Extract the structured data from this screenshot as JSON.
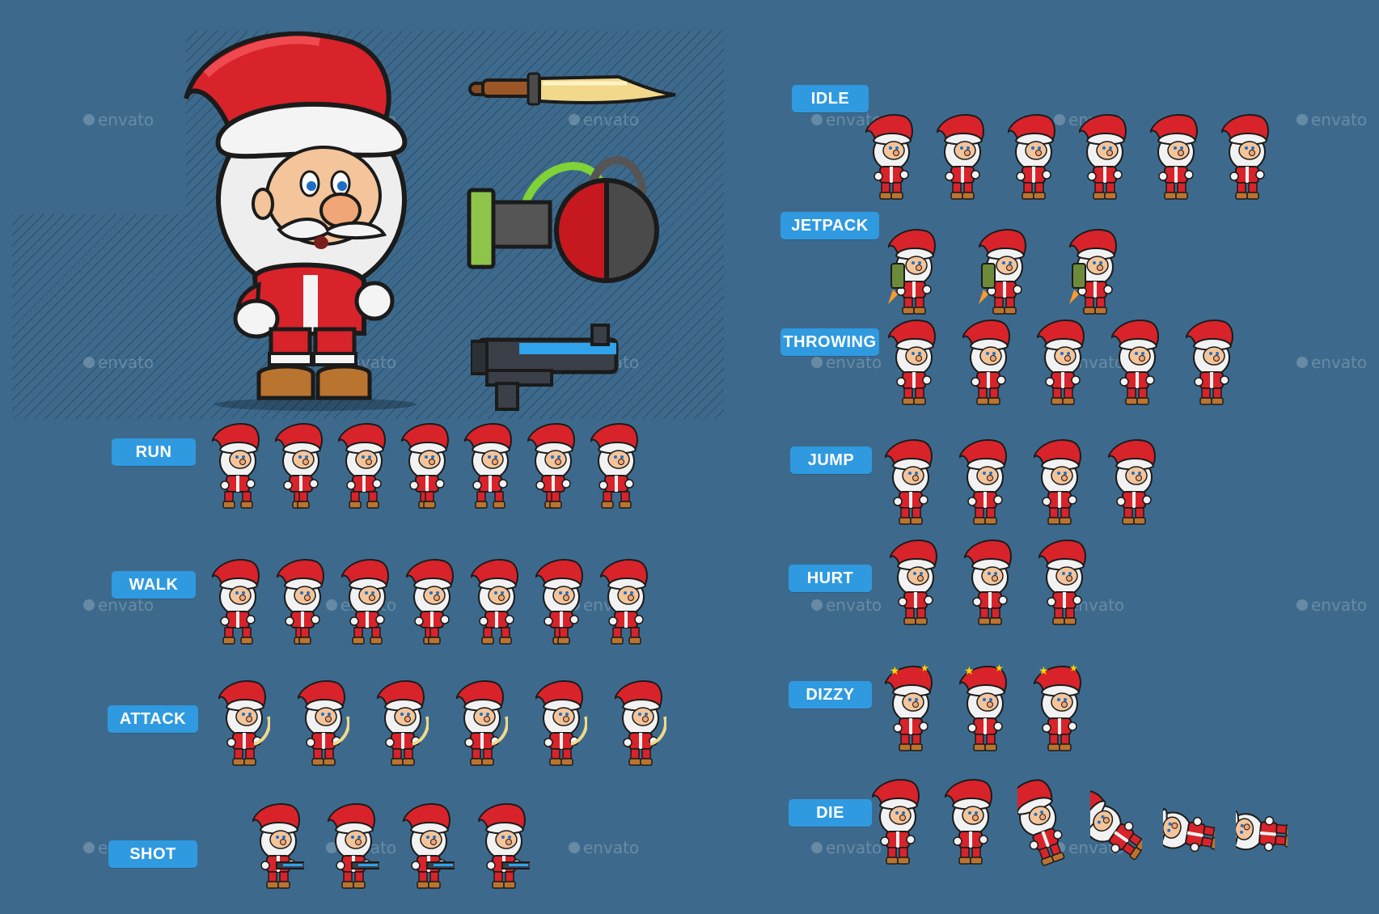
{
  "labels": {
    "run": "RUN",
    "walk": "WALK",
    "attack": "ATTACK",
    "shot": "SHOT",
    "idle": "IDLE",
    "jetpack": "JETPACK",
    "throwing": "THROWING",
    "jump": "JUMP",
    "hurt": "HURT",
    "dizzy": "DIZZY",
    "die": "DIE"
  },
  "watermark": "envato",
  "frames": {
    "run": 7,
    "walk": 7,
    "attack": 6,
    "shot": 4,
    "idle": 6,
    "jetpack": 3,
    "throwing": 5,
    "jump": 4,
    "hurt": 3,
    "dizzy": 3,
    "die": 6
  },
  "colors": {
    "background": "#3d6a8c",
    "label": "#2f9ae0",
    "suit_red": "#d8232a",
    "fur_white": "#f2f2f2",
    "skin": "#f4c49a"
  }
}
